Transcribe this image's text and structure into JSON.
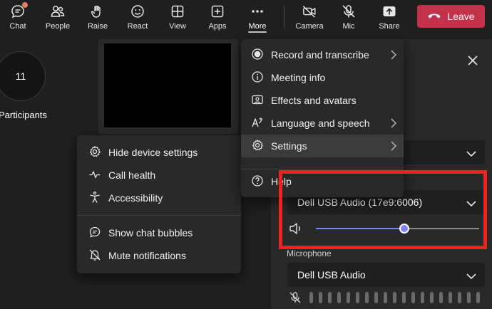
{
  "toolbar": {
    "items": [
      {
        "label": "Chat",
        "icon": "chat-icon"
      },
      {
        "label": "People",
        "icon": "people-icon"
      },
      {
        "label": "Raise",
        "icon": "raise-hand-icon"
      },
      {
        "label": "React",
        "icon": "react-smiley-icon"
      },
      {
        "label": "View",
        "icon": "grid-view-icon"
      },
      {
        "label": "Apps",
        "icon": "apps-plus-icon"
      },
      {
        "label": "More",
        "icon": "more-dots-icon"
      },
      {
        "label": "Camera",
        "icon": "camera-off-icon"
      },
      {
        "label": "Mic",
        "icon": "mic-off-icon"
      },
      {
        "label": "Share",
        "icon": "share-icon"
      }
    ],
    "leave_label": "Leave"
  },
  "stage": {
    "participants_count": "11",
    "participants_label": "Participants"
  },
  "more_menu": {
    "items": [
      {
        "label": "Record and transcribe",
        "icon": "record-icon",
        "has_submenu": true
      },
      {
        "label": "Meeting info",
        "icon": "info-icon",
        "has_submenu": false
      },
      {
        "label": "Effects and avatars",
        "icon": "effects-icon",
        "has_submenu": false
      },
      {
        "label": "Language and speech",
        "icon": "language-icon",
        "has_submenu": true
      },
      {
        "label": "Settings",
        "icon": "gear-icon",
        "has_submenu": true,
        "selected": true
      },
      {
        "label": "Help",
        "icon": "help-icon",
        "has_submenu": false
      }
    ]
  },
  "settings_submenu": {
    "items": [
      {
        "label": "Hide device settings",
        "icon": "gear-icon"
      },
      {
        "label": "Call health",
        "icon": "pulse-icon"
      },
      {
        "label": "Accessibility",
        "icon": "accessibility-icon"
      },
      {
        "label": "Show chat bubbles",
        "icon": "chat-bubble-icon"
      },
      {
        "label": "Mute notifications",
        "icon": "bell-off-icon"
      }
    ]
  },
  "device_panel": {
    "speaker_device": "Dell USB Audio (17e9:6006)",
    "microphone_label": "Microphone",
    "microphone_device": "Dell USB Audio",
    "speaker_volume_percent": 54
  },
  "colors": {
    "leave": "#c4314b",
    "accent": "#7f85f5",
    "highlight": "#ee2222"
  }
}
